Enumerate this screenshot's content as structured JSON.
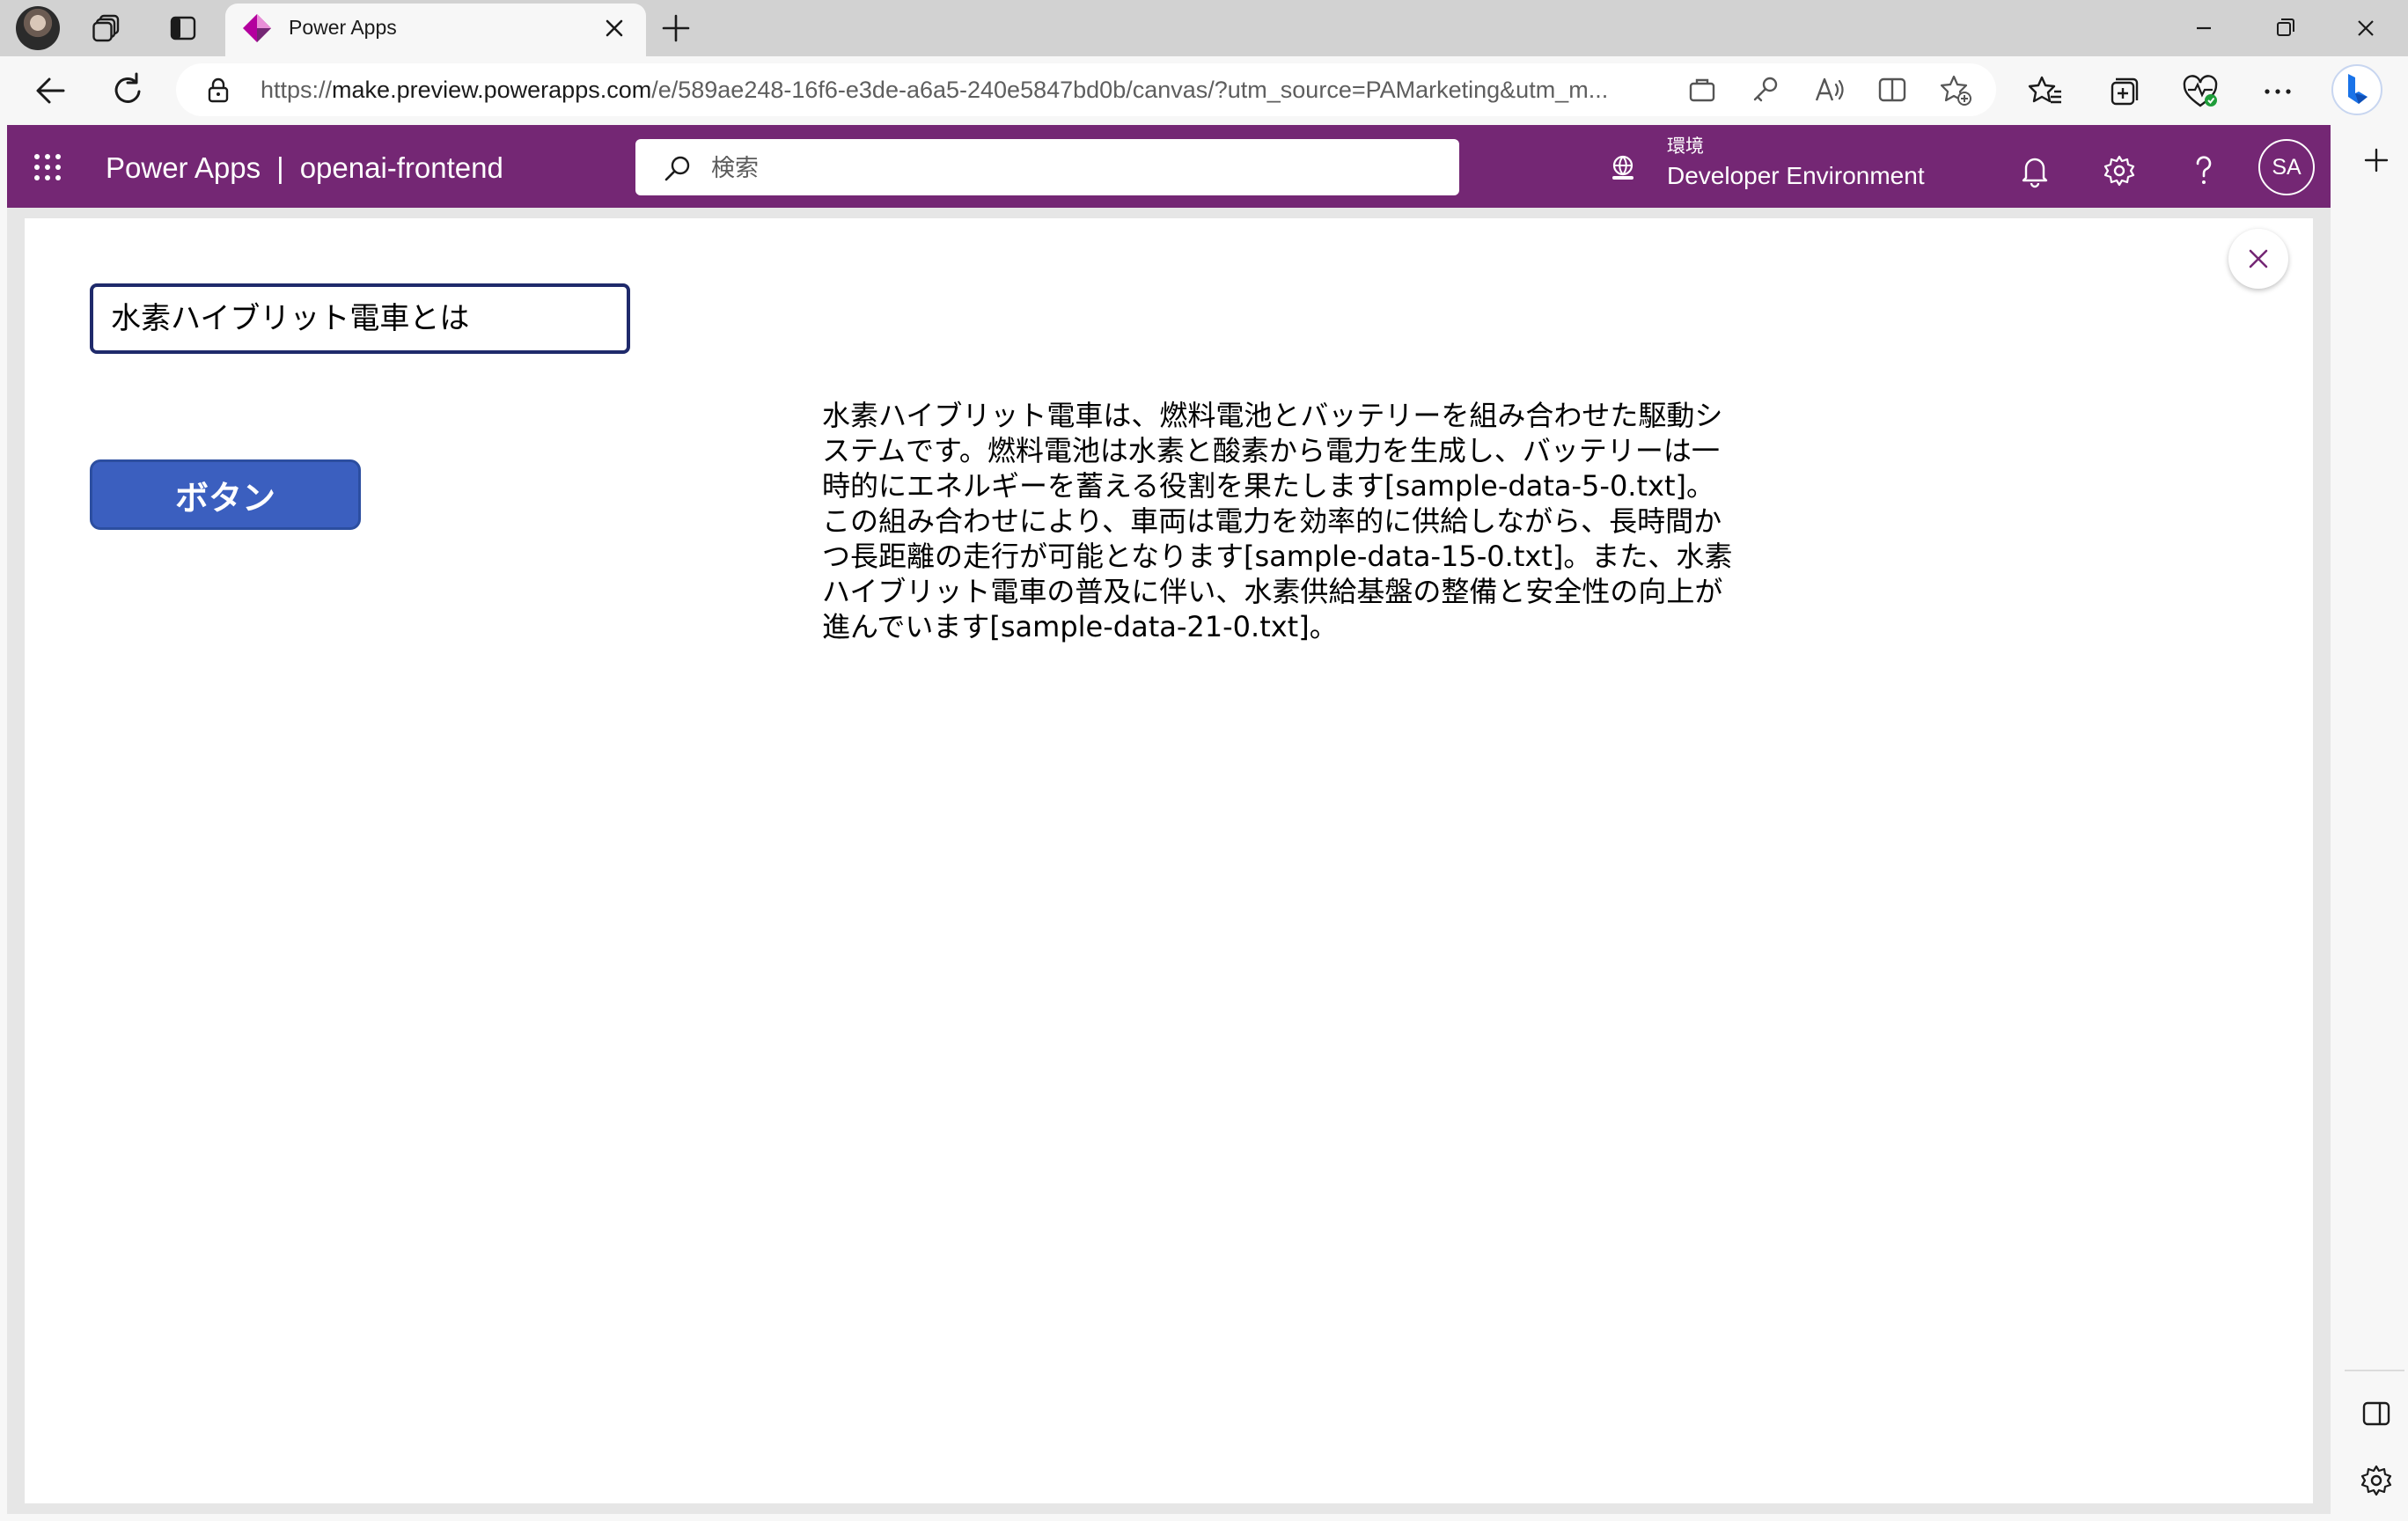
{
  "browser": {
    "tab_title": "Power Apps",
    "url_prefix": "https://",
    "url_host": "make.preview.powerapps.com",
    "url_path": "/e/589ae248-16f6-e3de-a6a5-240e5847bd0b/canvas/?utm_source=PAMarketing&utm_m..."
  },
  "header": {
    "product": "Power Apps",
    "separator": "|",
    "app_name": "openai-frontend",
    "search_placeholder": "検索",
    "environment_label": "環境",
    "environment_name": "Developer Environment",
    "avatar_initials": "SA"
  },
  "app": {
    "input_value": "水素ハイブリット電車とは",
    "button_label": "ボタン",
    "answer_text": "水素ハイブリット電車は、燃料電池とバッテリーを組み合わせた駆動システムです。燃料電池は水素と酸素から電力を生成し、バッテリーは一時的にエネルギーを蓄える役割を果たします[sample-data-5-0.txt]。この組み合わせにより、車両は電力を効率的に供給しながら、長時間かつ長距離の走行が可能となります[sample-data-15-0.txt]。また、水素ハイブリット電車の普及に伴い、水素供給基盤の整備と安全性の向上が進んでいます[sample-data-21-0.txt]。"
  },
  "colors": {
    "header_bg": "#742774",
    "button_bg": "#3b5fbf",
    "input_border": "#1f2a6b"
  },
  "icons": {
    "tab_strip": [
      "profile-avatar-icon",
      "workspaces-icon",
      "vertical-tabs-icon"
    ],
    "favicon": "power-apps-diamond-icon",
    "address_bar": [
      "app-available-icon",
      "key-icon",
      "read-aloud-icon",
      "split-screen-icon",
      "add-favorite-icon"
    ],
    "toolbar": [
      "favorites-icon",
      "collections-icon",
      "browser-essentials-icon",
      "more-icon",
      "copilot-icon"
    ],
    "powerapps_header": [
      "waffle-icon",
      "search-icon",
      "environment-icon",
      "bell-icon",
      "gear-icon",
      "help-icon"
    ]
  }
}
